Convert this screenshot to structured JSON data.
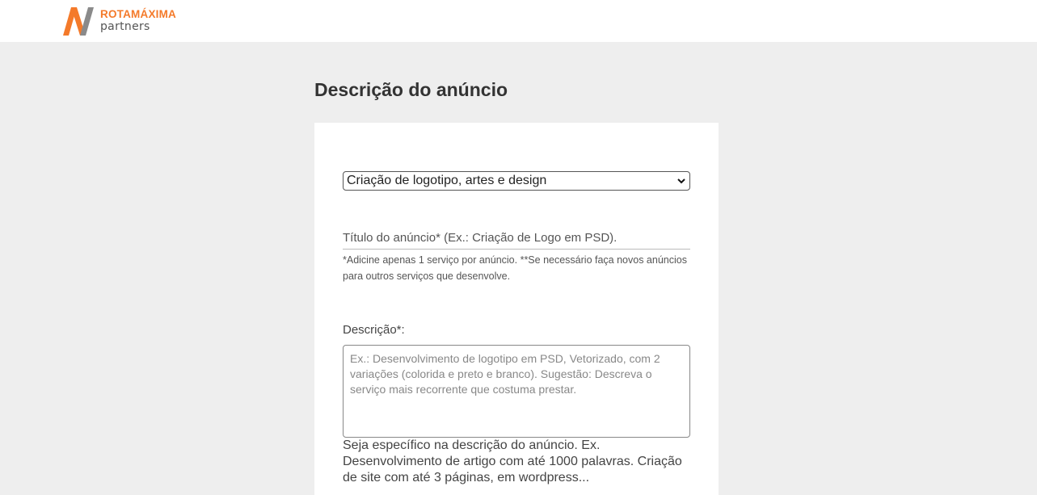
{
  "header": {
    "brand": "ROTAMÁXIMA",
    "sub": "partners",
    "colors": {
      "accent": "#f47a2a",
      "mark_secondary": "#8a8a8a"
    }
  },
  "page": {
    "title": "Descrição do anúncio"
  },
  "form": {
    "category": {
      "selected": "Criação de logotipo, artes e design",
      "icon": "chevron-down-icon"
    },
    "ad_title": {
      "placeholder": "Título do anúncio* (Ex.: Criação de Logo em PSD).",
      "hint": "*Adicine apenas 1 serviço por anúncio. **Se necessário faça novos anúncios para outros serviços que desenvolve."
    },
    "description": {
      "label": "Descrição*:",
      "placeholder": "Ex.: Desenvolvimento de logotipo em PSD, Vetorizado, com 2 variações (colorida e preto e branco).  Sugestão: Descreva o serviço mais recorrente que costuma prestar.",
      "hint": "Seja específico na descrição do anúncio. Ex. Desenvolvimento de artigo com até 1000 palavras. Criação de site com até 3 páginas, em wordpress..."
    }
  }
}
